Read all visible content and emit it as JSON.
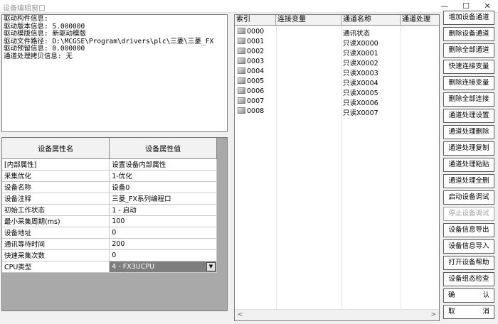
{
  "window": {
    "title": "设备编辑窗口",
    "minimize": "—",
    "maximize": "☐",
    "close": "✕"
  },
  "driver_info": {
    "lines": [
      "驱动构件信息:",
      "驱动版本信息: 5.000000",
      "驱动模版信息: 新驱动模版",
      "驱动文件路径: D:\\MCGSE\\Program\\drivers\\plc\\三菱\\三菱_FX",
      "驱动预留信息: 0.000000",
      "通道处理拷贝信息: 无"
    ]
  },
  "properties": {
    "headers": [
      "设备属性名",
      "设备属性值"
    ],
    "rows": [
      {
        "name": "[内部属性]",
        "value": "设置设备内部属性"
      },
      {
        "name": "采集优化",
        "value": "1-优化"
      },
      {
        "name": "设备名称",
        "value": "设备0"
      },
      {
        "name": "设备注释",
        "value": "三菱_FX系列编程口"
      },
      {
        "name": "初始工作状态",
        "value": "1 - 启动"
      },
      {
        "name": "最小采集周期(ms)",
        "value": "100"
      },
      {
        "name": "设备地址",
        "value": "0"
      },
      {
        "name": "通讯等待时间",
        "value": "200"
      },
      {
        "name": "快速采集次数",
        "value": "0"
      },
      {
        "name": "CPU类型",
        "value": "4 - FX3UCPU"
      }
    ],
    "dropdown_arrow": "▼"
  },
  "channels": {
    "headers": [
      "索引",
      "连接变量",
      "通道名称",
      "通道处理"
    ],
    "rows": [
      {
        "index": "0000",
        "variable": "",
        "name": "通讯状态"
      },
      {
        "index": "0001",
        "variable": "",
        "name": "只读X0000"
      },
      {
        "index": "0002",
        "variable": "",
        "name": "只读X0001"
      },
      {
        "index": "0003",
        "variable": "",
        "name": "只读X0002"
      },
      {
        "index": "0004",
        "variable": "",
        "name": "只读X0003"
      },
      {
        "index": "0005",
        "variable": "",
        "name": "只读X0004"
      },
      {
        "index": "0006",
        "variable": "",
        "name": "只读X0005"
      },
      {
        "index": "0007",
        "variable": "",
        "name": "只读X0006"
      },
      {
        "index": "0008",
        "variable": "",
        "name": "只读X0007"
      }
    ],
    "scroll_left": "<",
    "scroll_right": ">"
  },
  "buttons": {
    "add_channel": "增加设备通道",
    "delete_channel": "删除设备通道",
    "delete_all_channels": "删除全部通道",
    "quick_link_var": "快速连接变量",
    "delete_link_var": "删除连接变量",
    "delete_all_links": "删除全部连接",
    "channel_proc_set": "通道处理设置",
    "channel_proc_delete": "通道处理删除",
    "channel_proc_copy": "通道处理复制",
    "channel_proc_paste": "通道处理粘贴",
    "channel_proc_delete_all": "通道处理全删",
    "start_debug": "启动设备调试",
    "stop_debug": "停止设备调试",
    "export_info": "设备信息导出",
    "import_info": "设备信息导入",
    "open_help": "打开设备帮助",
    "config_check": "设备组态检查",
    "confirm_1": "确",
    "confirm_2": "认",
    "cancel_1": "取",
    "cancel_2": "消"
  }
}
